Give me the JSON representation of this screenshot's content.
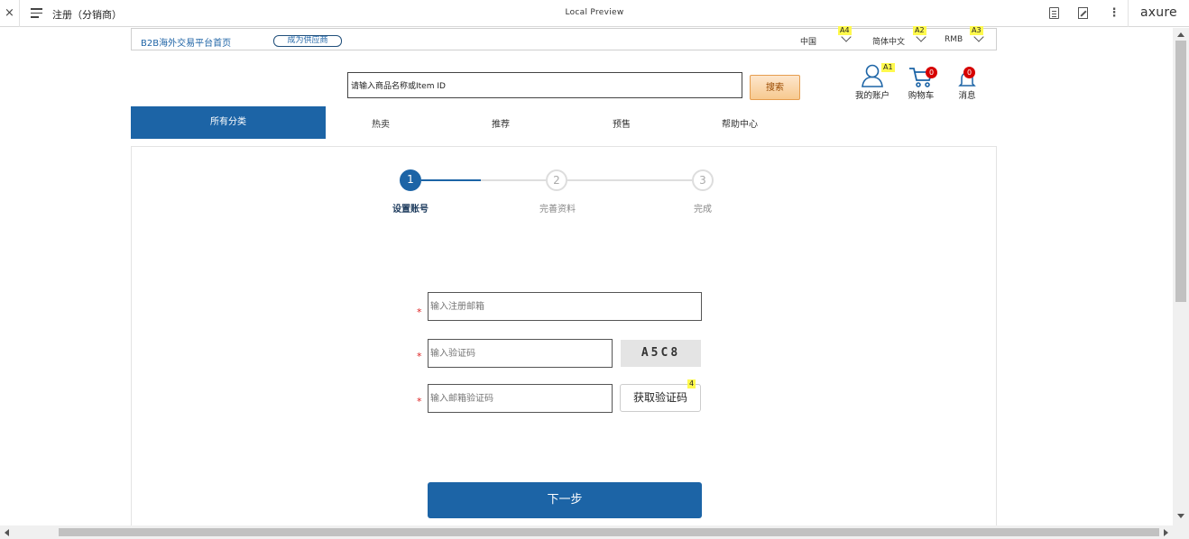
{
  "toolbar": {
    "close_glyph": "×",
    "page_title": "注册（分销商）",
    "center_label": "Local Preview",
    "more_glyph": "⋮",
    "logo": "axure"
  },
  "top_strip": {
    "home_link": "B2B海外交易平台首页",
    "supplier_button": "成为供应商",
    "region": "中国",
    "language": "简体中文",
    "currency": "RMB",
    "note_region": "A4",
    "note_language": "A2",
    "note_currency": "A3"
  },
  "search": {
    "value": "请输入商品名称或Item ID",
    "button": "搜索"
  },
  "header_icons": {
    "account_label": "我的账户",
    "account_note": "A1",
    "cart_label": "购物车",
    "cart_badge": "0",
    "message_label": "消息",
    "message_badge": "0"
  },
  "nav": {
    "all_categories": "所有分类",
    "items": [
      "热卖",
      "推荐",
      "预售",
      "帮助中心"
    ]
  },
  "steps": [
    {
      "number": "1",
      "label": "设置账号",
      "active": true
    },
    {
      "number": "2",
      "label": "完善资料",
      "active": false
    },
    {
      "number": "3",
      "label": "完成",
      "active": false
    }
  ],
  "form": {
    "required_mark": "*",
    "email_placeholder": "输入注册邮箱",
    "captcha_placeholder": "输入验证码",
    "captcha_text": "A5C8",
    "email_code_placeholder": "输入邮箱验证码",
    "get_code_button": "获取验证码",
    "get_code_note": "4",
    "next_button": "下一步"
  },
  "colors": {
    "primary": "#1c64a6",
    "badge": "#d60000",
    "note": "#fff94d",
    "search_button": "#f7c98f"
  }
}
